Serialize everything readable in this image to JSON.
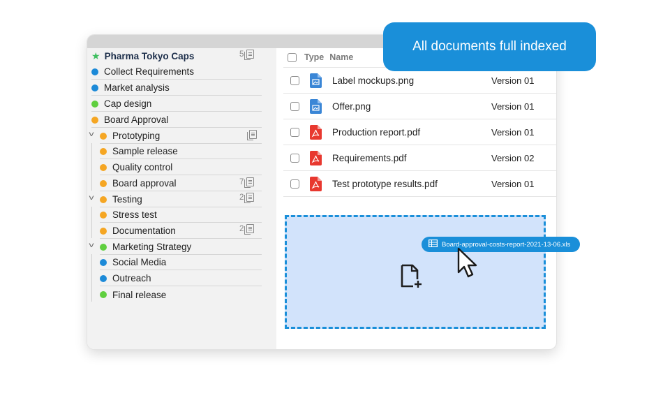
{
  "badge": {
    "text": "All documents full indexed"
  },
  "sidebar": {
    "root": {
      "label": "Pharma Tokyo Caps",
      "count": "5",
      "icon": "star-icon"
    },
    "items": [
      {
        "label": "Collect Requirements",
        "color": "#1c8ad8"
      },
      {
        "label": "Market analysis",
        "color": "#1c8ad8"
      },
      {
        "label": "Cap design",
        "color": "#5fcf3f"
      },
      {
        "label": "Board Approval",
        "color": "#f5a623"
      },
      {
        "label": "Prototyping",
        "color": "#f5a623",
        "expanded": true,
        "has_doc_icon": true,
        "children": [
          {
            "label": "Sample release",
            "color": "#f5a623"
          },
          {
            "label": "Quality control",
            "color": "#f5a623"
          },
          {
            "label": "Board approval",
            "color": "#f5a623",
            "count": "7"
          }
        ]
      },
      {
        "label": "Testing",
        "color": "#f5a623",
        "expanded": true,
        "count": "2",
        "children": [
          {
            "label": "Stress test",
            "color": "#f5a623"
          },
          {
            "label": "Documentation",
            "color": "#f5a623",
            "count": "2"
          }
        ]
      },
      {
        "label": "Marketing Strategy",
        "color": "#5fcf3f",
        "expanded": true,
        "children": [
          {
            "label": "Social Media",
            "color": "#1c8ad8"
          },
          {
            "label": "Outreach",
            "color": "#1c8ad8"
          },
          {
            "label": "Final release",
            "color": "#5fcf3f"
          }
        ]
      }
    ]
  },
  "file_list": {
    "header": {
      "type": "Type",
      "name": "Name"
    },
    "rows": [
      {
        "name": "Label mockups.png",
        "version": "Version 01",
        "icon": "image-file-icon",
        "icon_color": "#3a86d6"
      },
      {
        "name": "Offer.png",
        "version": "Version 01",
        "icon": "image-file-icon",
        "icon_color": "#3a86d6"
      },
      {
        "name": "Production report.pdf",
        "version": "Version 01",
        "icon": "pdf-file-icon",
        "icon_color": "#e8382f"
      },
      {
        "name": "Requirements.pdf",
        "version": "Version 02",
        "icon": "pdf-file-icon",
        "icon_color": "#e8382f"
      },
      {
        "name": "Test prototype results.pdf",
        "version": "Version 01",
        "icon": "pdf-file-icon",
        "icon_color": "#e8382f"
      }
    ]
  },
  "drag": {
    "filename": "Board-approval-costs-report-2021-13-06.xls",
    "icon": "spreadsheet-icon"
  },
  "dropzone": {
    "icon": "add-file-icon"
  },
  "colors": {
    "accent": "#1a8fd9",
    "dropzone_bg": "#d2e3fb",
    "sidebar_bg": "#f2f2f2"
  }
}
